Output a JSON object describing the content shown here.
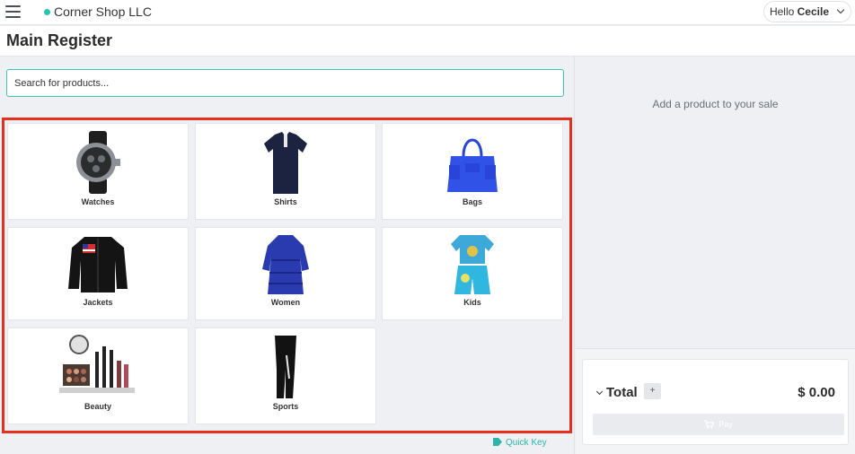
{
  "header": {
    "store_name": "Corner Shop LLC",
    "greeting": "Hello",
    "user_name": "Cecile"
  },
  "page_title": "Main Register",
  "search": {
    "placeholder": "Search for products..."
  },
  "categories": [
    {
      "label": "Watches",
      "icon": "watch-image"
    },
    {
      "label": "Shirts",
      "icon": "shirt-image"
    },
    {
      "label": "Bags",
      "icon": "bag-image"
    },
    {
      "label": "Jackets",
      "icon": "jacket-image"
    },
    {
      "label": "Women",
      "icon": "dress-image"
    },
    {
      "label": "Kids",
      "icon": "kids-outfit-image"
    },
    {
      "label": "Beauty",
      "icon": "cosmetics-image"
    },
    {
      "label": "Sports",
      "icon": "leggings-image"
    }
  ],
  "quick_key_label": "Quick Key",
  "sale": {
    "empty_message": "Add a product to your sale",
    "total_label": "Total",
    "add_label": "+",
    "total_value": "$ 0.00",
    "pay_label": "Pay"
  },
  "colors": {
    "accent": "#2bb5aa",
    "highlight_frame": "#e4301c"
  }
}
